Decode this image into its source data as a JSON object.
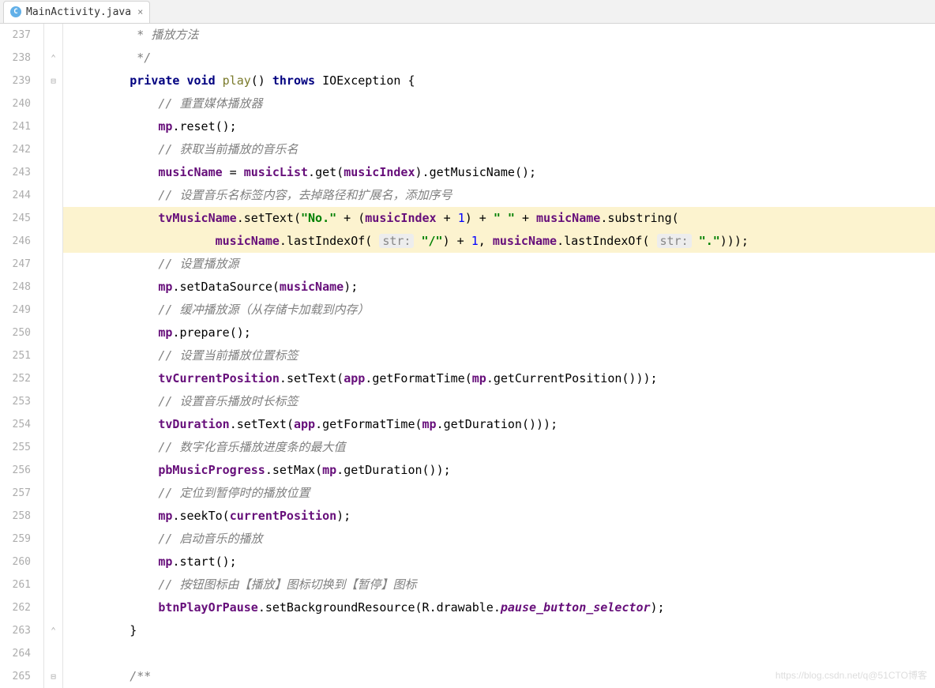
{
  "tab": {
    "label": "MainActivity.java"
  },
  "watermarks": {
    "left": "https://blog.csdn.net/q",
    "right": "@51CTO博客"
  },
  "gutter": {
    "lines": [
      237,
      238,
      239,
      240,
      241,
      242,
      243,
      244,
      245,
      246,
      247,
      248,
      249,
      250,
      251,
      252,
      253,
      254,
      255,
      256,
      257,
      258,
      259,
      260,
      261,
      262,
      263,
      264,
      265
    ]
  },
  "code": {
    "l237": "         * 播放方法",
    "l238": "         */",
    "l239_kw1": "private",
    "l239_kw2": "void",
    "l239_method": "play",
    "l239_kw3": "throws",
    "l239_ex": "IOException",
    "l240": "            // 重置媒体播放器",
    "l241_obj": "mp",
    "l241_m": "reset",
    "l242": "            // 获取当前播放的音乐名",
    "l243_a": "musicName",
    "l243_b": "musicList",
    "l243_m1": "get",
    "l243_c": "musicIndex",
    "l243_m2": "getMusicName",
    "l244": "            // 设置音乐名标签内容，去掉路径和扩展名，添加序号",
    "l245_a": "tvMusicName",
    "l245_m": "setText",
    "l245_s1": "\"No.\"",
    "l245_b": "musicIndex",
    "l245_n": "1",
    "l245_s2": "\" \"",
    "l245_c": "musicName",
    "l245_m2": "substring",
    "l246_a": "musicName",
    "l246_m1": "lastIndexOf",
    "l246_h": "str:",
    "l246_s1": "\"/\"",
    "l246_n": "1",
    "l246_b": "musicName",
    "l246_m2": "lastIndexOf",
    "l246_s2": "\".\"",
    "l247": "            // 设置播放源",
    "l248_a": "mp",
    "l248_m": "setDataSource",
    "l248_b": "musicName",
    "l249": "            // 缓冲播放源（从存储卡加载到内存）",
    "l250_a": "mp",
    "l250_m": "prepare",
    "l251": "            // 设置当前播放位置标签",
    "l252_a": "tvCurrentPosition",
    "l252_m1": "setText",
    "l252_b": "app",
    "l252_m2": "getFormatTime",
    "l252_c": "mp",
    "l252_m3": "getCurrentPosition",
    "l253": "            // 设置音乐播放时长标签",
    "l254_a": "tvDuration",
    "l254_m1": "setText",
    "l254_b": "app",
    "l254_m2": "getFormatTime",
    "l254_c": "mp",
    "l254_m3": "getDuration",
    "l255": "            // 数字化音乐播放进度条的最大值",
    "l256_a": "pbMusicProgress",
    "l256_m1": "setMax",
    "l256_b": "mp",
    "l256_m2": "getDuration",
    "l257": "            // 定位到暂停时的播放位置",
    "l258_a": "mp",
    "l258_m": "seekTo",
    "l258_b": "currentPosition",
    "l259": "            // 启动音乐的播放",
    "l260_a": "mp",
    "l260_m": "start",
    "l261": "            // 按钮图标由【播放】图标切换到【暂停】图标",
    "l262_a": "btnPlayOrPause",
    "l262_m": "setBackgroundResource",
    "l262_b": "R",
    "l262_c": "drawable",
    "l262_d": "pause_button_selector",
    "l263": "        }",
    "l265": "        /**"
  }
}
